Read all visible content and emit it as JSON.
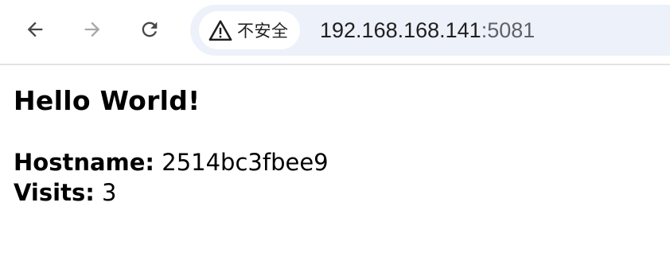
{
  "browser": {
    "security_label": "不安全",
    "url_host": "192.168.168.141",
    "url_port": ":5081",
    "icons": {
      "back": "arrow-left-icon",
      "forward": "arrow-right-icon",
      "reload": "reload-icon",
      "security": "warning-triangle-icon"
    },
    "forward_enabled": false
  },
  "page": {
    "heading": "Hello World!",
    "hostname_label": "Hostname:",
    "hostname_value": "2514bc3fbee9",
    "visits_label": "Visits:",
    "visits_value": "3"
  }
}
